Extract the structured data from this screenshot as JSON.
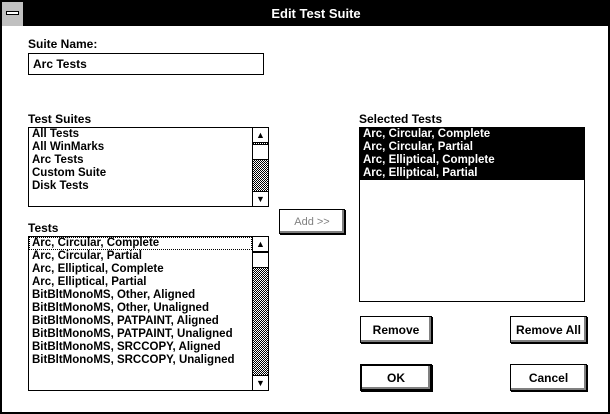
{
  "window": {
    "title": "Edit Test Suite"
  },
  "suite_name": {
    "label": "Suite Name:",
    "value": "Arc Tests"
  },
  "test_suites": {
    "label": "Test Suites",
    "items": [
      "All Tests",
      "All WinMarks",
      "Arc Tests",
      "Custom Suite",
      "Disk Tests"
    ]
  },
  "tests": {
    "label": "Tests",
    "items": [
      "Arc, Circular, Complete",
      "Arc, Circular, Partial",
      "Arc, Elliptical, Complete",
      "Arc, Elliptical, Partial",
      "BitBltMonoMS, Other, Aligned",
      "BitBltMonoMS, Other, Unaligned",
      "BitBltMonoMS, PATPAINT, Aligned",
      "BitBltMonoMS, PATPAINT, Unaligned",
      "BitBltMonoMS, SRCCOPY, Aligned",
      "BitBltMonoMS, SRCCOPY, Unaligned"
    ]
  },
  "selected_tests": {
    "label": "Selected Tests",
    "items": [
      "Arc, Circular, Complete",
      "Arc, Circular, Partial",
      "Arc, Elliptical, Complete",
      "Arc, Elliptical, Partial"
    ]
  },
  "buttons": {
    "add": "Add >>",
    "remove": "Remove",
    "remove_all": "Remove All",
    "ok": "OK",
    "cancel": "Cancel"
  },
  "icons": {
    "scroll_up": "▲",
    "scroll_down": "▼"
  },
  "colors": {
    "title_bar": "#000000",
    "selection": "#000000",
    "disabled_text": "#808080"
  }
}
